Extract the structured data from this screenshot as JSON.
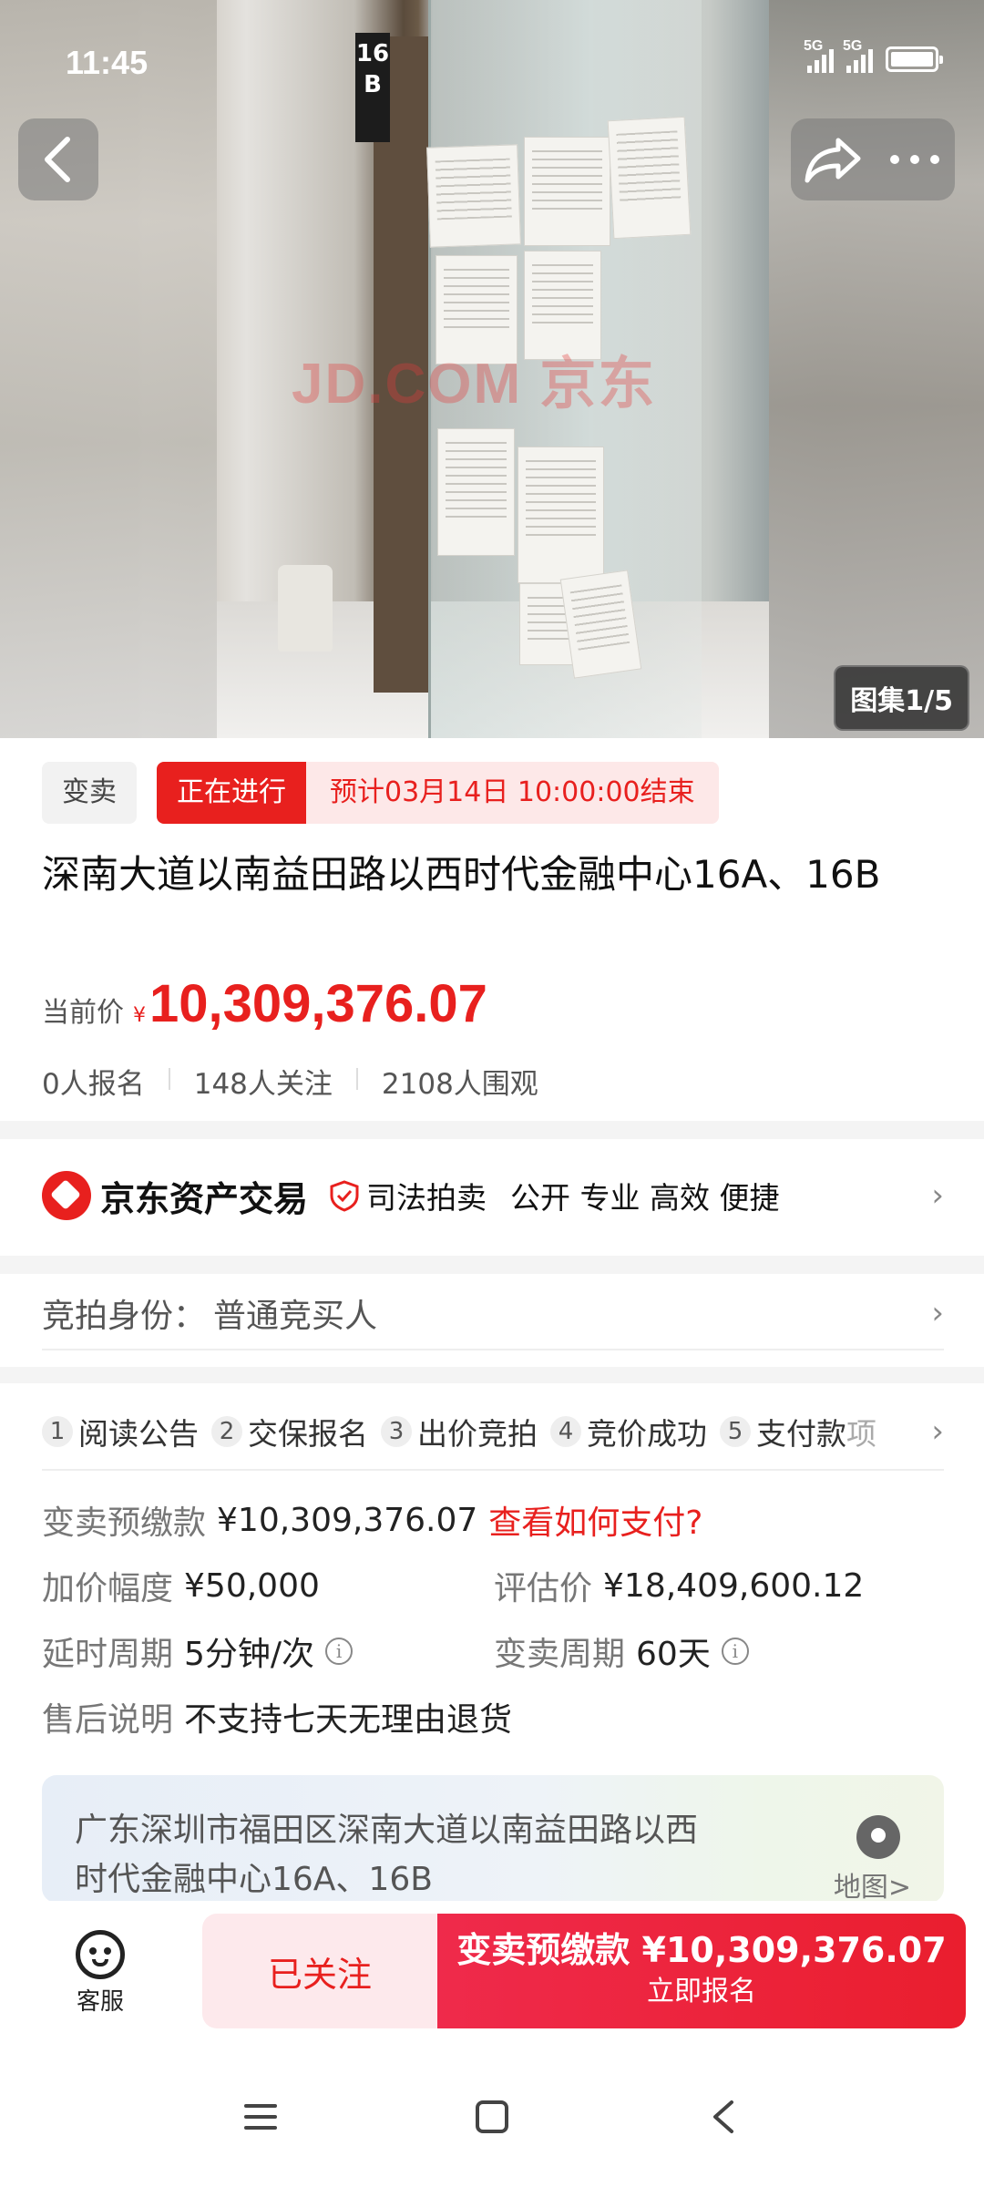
{
  "status_bar": {
    "time": "11:45",
    "net1": "5G",
    "net2": "5G"
  },
  "hero": {
    "gallery_label": "图集1/5",
    "watermark": "JD.COM 京东",
    "door_sign": "16B"
  },
  "tags": {
    "type": "变卖",
    "status": "正在进行",
    "end_time": "预计03月14日 10:00:00结束"
  },
  "title": "深南大道以南益田路以西时代金融中心16A、16B",
  "price": {
    "label": "当前价",
    "currency": "¥",
    "value": "10,309,376.07"
  },
  "stats": {
    "signups": "0人报名",
    "followers": "148人关注",
    "views": "2108人围观"
  },
  "platform": {
    "name": "京东资产交易",
    "badge": "司法拍卖",
    "slogan": "公开 专业 高效 便捷"
  },
  "identity": {
    "label": "竞拍身份：",
    "value": "普通竞买人"
  },
  "steps": [
    {
      "num": "1",
      "label": "阅读公告"
    },
    {
      "num": "2",
      "label": "交保报名"
    },
    {
      "num": "3",
      "label": "出价竞拍"
    },
    {
      "num": "4",
      "label": "竞价成功"
    },
    {
      "num": "5",
      "label": "支付款",
      "fade": "项"
    }
  ],
  "details": {
    "deposit_label": "变卖预缴款",
    "deposit_value": "¥10,309,376.07",
    "deposit_link": "查看如何支付?",
    "increment_label": "加价幅度",
    "increment_value": "¥50,000",
    "appraisal_label": "评估价",
    "appraisal_value": "¥18,409,600.12",
    "delay_label": "延时周期",
    "delay_value": "5分钟/次",
    "period_label": "变卖周期",
    "period_value": "60天",
    "aftersale_label": "售后说明",
    "aftersale_value": "不支持七天无理由退货"
  },
  "address": {
    "line1": "广东深圳市福田区深南大道以南益田路以西",
    "line2": "时代金融中心16A、16B",
    "map_label": "地图>"
  },
  "action_bar": {
    "service_label": "客服",
    "follow_label": "已关注",
    "signup_main": "变卖预缴款 ¥10,309,376.07",
    "signup_sub": "立即报名"
  },
  "colors": {
    "accent": "#e8201e",
    "follow_bg": "#fde9ec"
  }
}
